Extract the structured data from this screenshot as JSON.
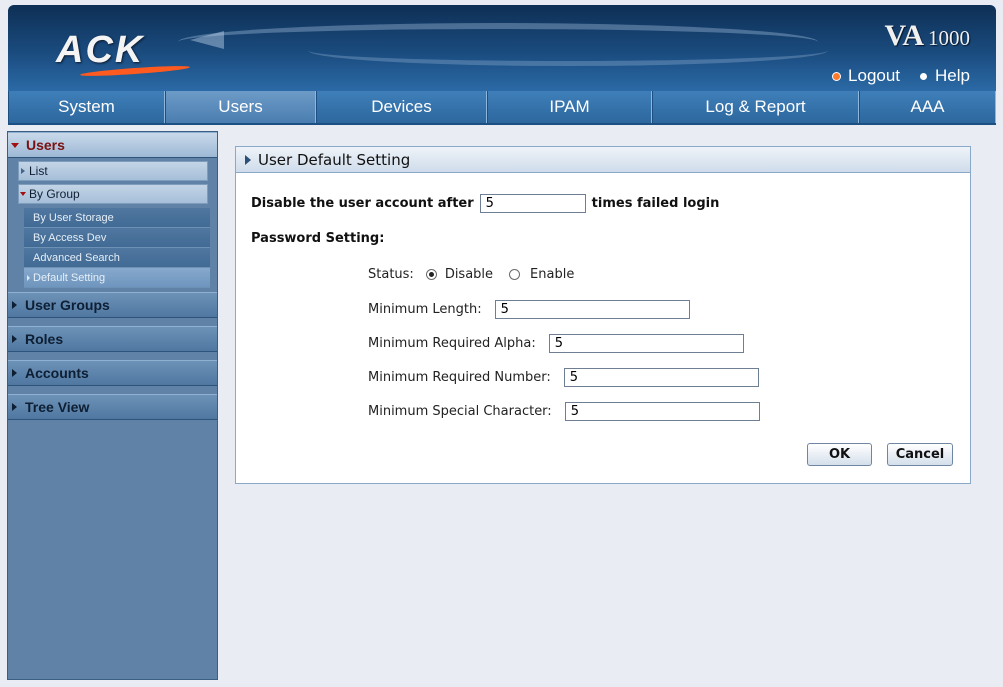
{
  "brand": {
    "logo": "ACK",
    "product_name": "VA",
    "product_model": "1000",
    "accent": "#ff5a1f"
  },
  "header": {
    "logout": "Logout",
    "help": "Help"
  },
  "nav": {
    "items": [
      "System",
      "Users",
      "Devices",
      "IPAM",
      "Log & Report",
      "AAA"
    ],
    "active": "Users"
  },
  "sidebar": {
    "users": "Users",
    "list": "List",
    "by_group": "By Group",
    "leaves": [
      "By User Storage",
      "By Access Dev",
      "Advanced Search",
      "Default Setting"
    ],
    "active_leaf": "Default Setting",
    "sections": [
      "User Groups",
      "Roles",
      "Accounts",
      "Tree View"
    ]
  },
  "panel": {
    "title": "User Default Setting",
    "disable_prefix": "Disable the user account after",
    "disable_value": "5",
    "disable_suffix": "times failed login",
    "password_setting": "Password Setting:",
    "status_label": "Status:",
    "status_disable": "Disable",
    "status_enable": "Enable",
    "status_selected": "Disable",
    "min_length_label": "Minimum Length:",
    "min_length_value": "5",
    "min_alpha_label": "Minimum Required Alpha:",
    "min_alpha_value": "5",
    "min_number_label": "Minimum Required Number:",
    "min_number_value": "5",
    "min_special_label": "Minimum Special Character:",
    "min_special_value": "5",
    "ok": "OK",
    "cancel": "Cancel"
  }
}
